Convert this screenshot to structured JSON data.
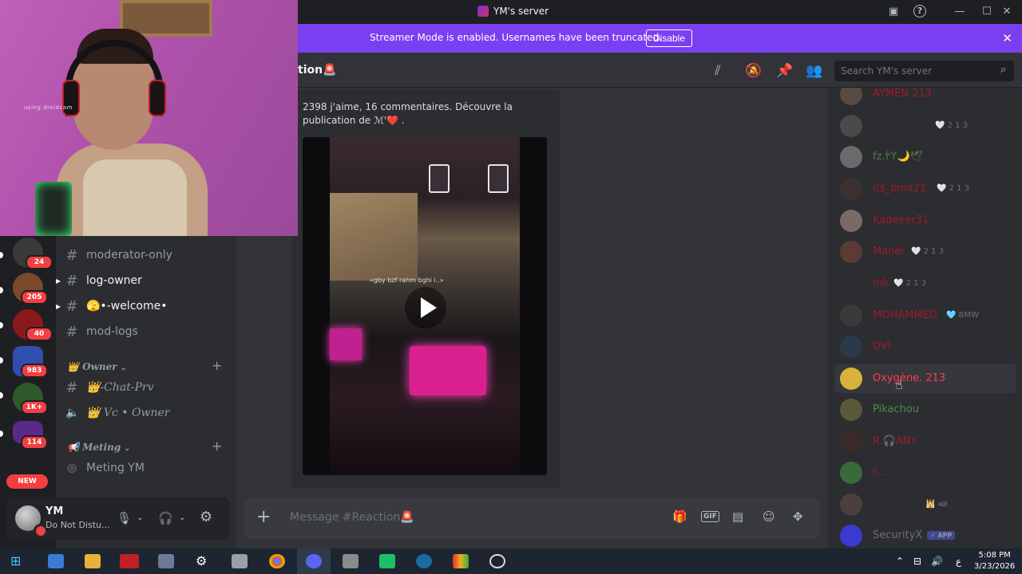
{
  "window": {
    "title": "YM's server"
  },
  "banner": {
    "text": "Streamer Mode is enabled. Usernames have been truncated.",
    "button": "Disable"
  },
  "servers": [
    {
      "badge": "24",
      "color": "#3a3a3a"
    },
    {
      "badge": "205",
      "color": "#7a4a2a"
    },
    {
      "badge": "40",
      "color": "#8a1a1a"
    },
    {
      "badge": "983",
      "color": "#2f4fae"
    },
    {
      "badge": "1K+",
      "color": "#2e5a2e"
    },
    {
      "badge": "114",
      "color": "#5a2a8a"
    }
  ],
  "new_pill": "NEW",
  "channels": {
    "items": [
      "moderator-only",
      "log-owner",
      "🫣•-welcome•",
      "mod-logs"
    ],
    "category_owner": "👑 Owner",
    "owner_items": [
      "👑-Chat-Prv",
      "👑 Vc • Owner"
    ],
    "category_meeting": "📢 Meting",
    "meeting_items": [
      "Meting YM"
    ]
  },
  "user": {
    "name": "YM",
    "status": "Do Not Distu..."
  },
  "chat": {
    "channel_title": "tion🚨",
    "search_placeholder": "Search YM's server",
    "embed_description": "2398 j'aime, 16 commentaires. Découvre la publication de ℳ'❤️ .",
    "video_caption": "«gby bzf rahm bghi i..»",
    "composer_placeholder": "Message #Reaction🚨"
  },
  "members": [
    {
      "name": "AYMEN 213",
      "color": "#a01a2a",
      "avatar": "#5a4a44",
      "extra": ""
    },
    {
      "name": "",
      "color": "#7a7d85",
      "avatar": "#4a4a4a",
      "extra": "🤍 2 1 3"
    },
    {
      "name": "fz.ٰ٢Y🌙🕊",
      "color": "#4f7a4a",
      "avatar": "#6a6a6a",
      "extra": ""
    },
    {
      "name": "its_bmx21",
      "color": "#a01a2a",
      "avatar": "#3c3030",
      "extra": "🤍 2 1 3"
    },
    {
      "name": "Kadeeer31",
      "color": "#a01a2a",
      "avatar": "#7a6a64",
      "extra": ""
    },
    {
      "name": "Manel",
      "color": "#a01a2a",
      "avatar": "#5a3c34",
      "extra": "🤍 2 1 3"
    },
    {
      "name": "mk",
      "color": "#a01a2a",
      "avatar": "#2b2d31",
      "extra": "🤍 2 1 3"
    },
    {
      "name": "MOHAMMED",
      "color": "#a01a2a",
      "avatar": "#3a3a3a",
      "extra": "🩵 BMW"
    },
    {
      "name": "OVI",
      "color": "#a01a2a",
      "avatar": "#2a3a4a",
      "extra": ""
    },
    {
      "name": "Oxygène. 213",
      "color": "#ff3b4e",
      "avatar": "#d8b23a",
      "extra": ""
    },
    {
      "name": "Pikachou",
      "color": "#4f8a4a",
      "avatar": "#5a5a3a",
      "extra": ""
    },
    {
      "name": "R.🎧AN⚡",
      "color": "#a01a2a",
      "avatar": "#3a2a2a",
      "extra": ""
    },
    {
      "name": "r...",
      "color": "#a01a2a",
      "avatar": "#3a6a3a",
      "extra": ""
    },
    {
      "name": "",
      "color": "#7a7d85",
      "avatar": "#4a4040",
      "extra": "🕌 ﷲ"
    },
    {
      "name": "SecurityX",
      "color": "#6d6f78",
      "avatar": "#3a3ad0",
      "extra": "",
      "tag": "✓ APP"
    }
  ],
  "webcam": {
    "watermark": "using droidcam"
  },
  "taskbar": {
    "time": "5:08 PM",
    "date": "3/23/2026",
    "lang": "ع"
  }
}
